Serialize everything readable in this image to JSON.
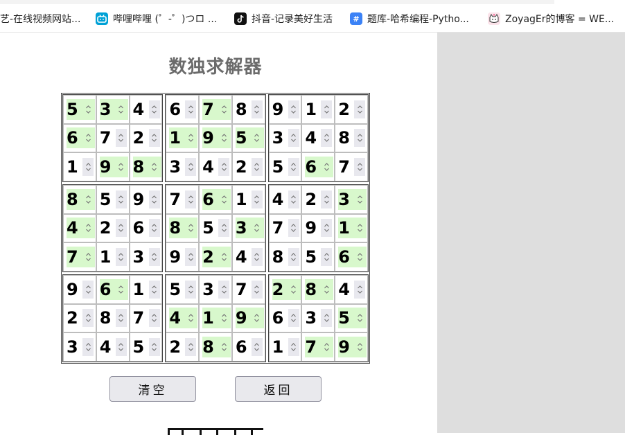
{
  "bookmarks": [
    {
      "label": "艺-在线视频网站...",
      "icon": "",
      "color": ""
    },
    {
      "label": "哔哩哔哩 (゜-゜)つロ ...",
      "icon": "bilibili-icon",
      "color": "#00a1d6"
    },
    {
      "label": "抖音-记录美好生活",
      "icon": "tiktok-icon",
      "color": "#111111"
    },
    {
      "label": "题库-哈希编程-Pytho...",
      "icon": "hash-icon",
      "color": "#3b82f6"
    },
    {
      "label": "ZoyagEr的博客 = WE...",
      "icon": "cat-icon",
      "color": "#f5c7d6"
    }
  ],
  "title": "数独求解器",
  "board": [
    [
      {
        "v": "5",
        "g": true
      },
      {
        "v": "3",
        "g": true
      },
      {
        "v": "4",
        "g": false
      },
      {
        "v": "6",
        "g": false
      },
      {
        "v": "7",
        "g": true
      },
      {
        "v": "8",
        "g": false
      },
      {
        "v": "9",
        "g": false
      },
      {
        "v": "1",
        "g": false
      },
      {
        "v": "2",
        "g": false
      }
    ],
    [
      {
        "v": "6",
        "g": true
      },
      {
        "v": "7",
        "g": false
      },
      {
        "v": "2",
        "g": false
      },
      {
        "v": "1",
        "g": true
      },
      {
        "v": "9",
        "g": true
      },
      {
        "v": "5",
        "g": true
      },
      {
        "v": "3",
        "g": false
      },
      {
        "v": "4",
        "g": false
      },
      {
        "v": "8",
        "g": false
      }
    ],
    [
      {
        "v": "1",
        "g": false
      },
      {
        "v": "9",
        "g": true
      },
      {
        "v": "8",
        "g": true
      },
      {
        "v": "3",
        "g": false
      },
      {
        "v": "4",
        "g": false
      },
      {
        "v": "2",
        "g": false
      },
      {
        "v": "5",
        "g": false
      },
      {
        "v": "6",
        "g": true
      },
      {
        "v": "7",
        "g": false
      }
    ],
    [
      {
        "v": "8",
        "g": true
      },
      {
        "v": "5",
        "g": false
      },
      {
        "v": "9",
        "g": false
      },
      {
        "v": "7",
        "g": false
      },
      {
        "v": "6",
        "g": true
      },
      {
        "v": "1",
        "g": false
      },
      {
        "v": "4",
        "g": false
      },
      {
        "v": "2",
        "g": false
      },
      {
        "v": "3",
        "g": true
      }
    ],
    [
      {
        "v": "4",
        "g": true
      },
      {
        "v": "2",
        "g": false
      },
      {
        "v": "6",
        "g": false
      },
      {
        "v": "8",
        "g": true
      },
      {
        "v": "5",
        "g": false
      },
      {
        "v": "3",
        "g": true
      },
      {
        "v": "7",
        "g": false
      },
      {
        "v": "9",
        "g": false
      },
      {
        "v": "1",
        "g": true
      }
    ],
    [
      {
        "v": "7",
        "g": true
      },
      {
        "v": "1",
        "g": false
      },
      {
        "v": "3",
        "g": false
      },
      {
        "v": "9",
        "g": false
      },
      {
        "v": "2",
        "g": true
      },
      {
        "v": "4",
        "g": false
      },
      {
        "v": "8",
        "g": false
      },
      {
        "v": "5",
        "g": false
      },
      {
        "v": "6",
        "g": true
      }
    ],
    [
      {
        "v": "9",
        "g": false
      },
      {
        "v": "6",
        "g": true
      },
      {
        "v": "1",
        "g": false
      },
      {
        "v": "5",
        "g": false
      },
      {
        "v": "3",
        "g": false
      },
      {
        "v": "7",
        "g": false
      },
      {
        "v": "2",
        "g": true
      },
      {
        "v": "8",
        "g": true
      },
      {
        "v": "4",
        "g": false
      }
    ],
    [
      {
        "v": "2",
        "g": false
      },
      {
        "v": "8",
        "g": false
      },
      {
        "v": "7",
        "g": false
      },
      {
        "v": "4",
        "g": true
      },
      {
        "v": "1",
        "g": true
      },
      {
        "v": "9",
        "g": true
      },
      {
        "v": "6",
        "g": false
      },
      {
        "v": "3",
        "g": false
      },
      {
        "v": "5",
        "g": true
      }
    ],
    [
      {
        "v": "3",
        "g": false
      },
      {
        "v": "4",
        "g": false
      },
      {
        "v": "5",
        "g": false
      },
      {
        "v": "2",
        "g": false
      },
      {
        "v": "8",
        "g": true
      },
      {
        "v": "6",
        "g": false
      },
      {
        "v": "1",
        "g": false
      },
      {
        "v": "7",
        "g": true
      },
      {
        "v": "9",
        "g": true
      }
    ]
  ],
  "buttons": {
    "clear": "清空",
    "back": "返回"
  },
  "colors": {
    "given_cell": "#d8f8cc",
    "title": "#6b6b6b",
    "side_panel": "#dedede"
  }
}
